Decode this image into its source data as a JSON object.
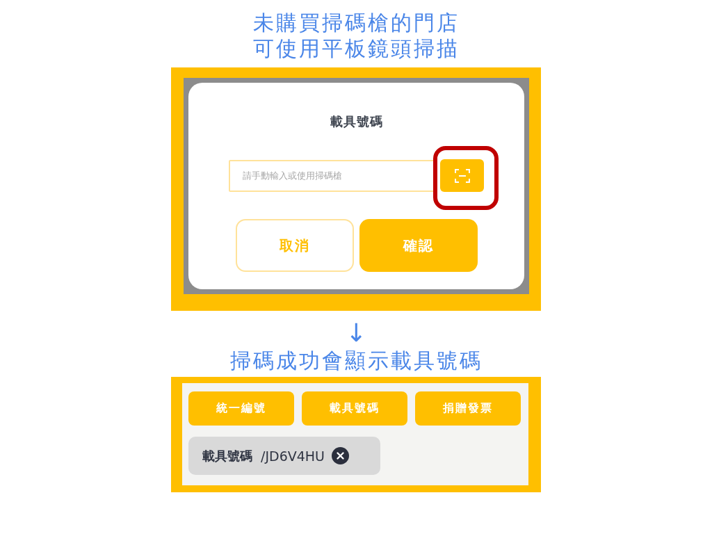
{
  "intro_caption": {
    "lines": [
      "未購買掃碼槍的門店",
      "可使用平板鏡頭掃描"
    ]
  },
  "dialog_panel": {
    "title": "載具號碼",
    "input": {
      "placeholder": "請手動輸入或使用掃碼槍"
    },
    "scan_highlighted": true,
    "buttons": [
      {
        "label": "取消",
        "kind": "outline"
      },
      {
        "label": "確認",
        "kind": "filled"
      }
    ]
  },
  "arrow": "↓",
  "result_caption": "掃碼成功會顯示載具號碼",
  "result_panel": {
    "tabs": [
      {
        "label": "統一編號"
      },
      {
        "label": "載具號碼"
      },
      {
        "label": "捐贈發票"
      }
    ],
    "chip": {
      "label": "載具號碼",
      "value": "/JD6V4HU"
    }
  }
}
